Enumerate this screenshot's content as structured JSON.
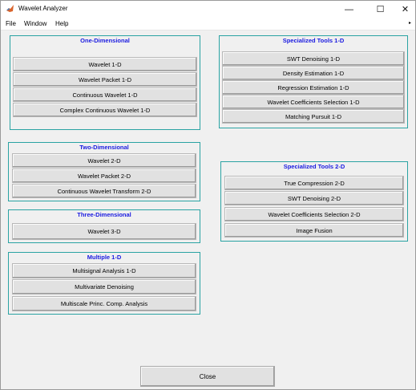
{
  "window": {
    "title": "Wavelet Analyzer",
    "minimize": "—",
    "maximize": "☐",
    "close": "✕"
  },
  "menu": {
    "file": "File",
    "window": "Window",
    "help": "Help",
    "overflow": "▸"
  },
  "panels": {
    "one_d": {
      "title": "One-Dimensional",
      "buttons": [
        "Wavelet 1-D",
        "Wavelet Packet 1-D",
        "Continuous Wavelet 1-D",
        "Complex Continuous Wavelet 1-D"
      ]
    },
    "two_d": {
      "title": "Two-Dimensional",
      "buttons": [
        "Wavelet 2-D",
        "Wavelet Packet 2-D",
        "Continuous Wavelet Transform 2-D"
      ]
    },
    "three_d": {
      "title": "Three-Dimensional",
      "buttons": [
        "Wavelet 3-D"
      ]
    },
    "multiple": {
      "title": "Multiple 1-D",
      "buttons": [
        "Multisignal Analysis 1-D",
        "Multivariate Denoising",
        "Multiscale Princ. Comp. Analysis"
      ]
    },
    "spec_1d": {
      "title": "Specialized Tools 1-D",
      "buttons": [
        "SWT Denoising 1-D",
        "Density Estimation 1-D",
        "Regression Estimation 1-D",
        "Wavelet Coefficients Selection 1-D",
        "Matching Pursuit 1-D"
      ]
    },
    "spec_2d": {
      "title": "Specialized Tools 2-D",
      "buttons": [
        "True Compression 2-D",
        "SWT Denoising 2-D",
        "Wavelet Coefficients Selection 2-D",
        "Image Fusion"
      ]
    }
  },
  "close_label": "Close",
  "colors": {
    "panel_border": "#2aa3a3",
    "panel_title": "#1a1ae0"
  }
}
